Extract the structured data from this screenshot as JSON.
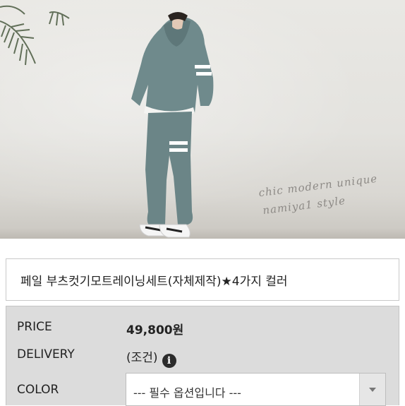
{
  "photo": {
    "alt_script_line1": "chic modern unique",
    "alt_script_line2": "namiya1 style"
  },
  "product": {
    "title": "페일 부츠컷기모트레이닝세트(자체제작)★4가지 컬러"
  },
  "info": {
    "price_label": "PRICE",
    "price_value": "49,800원",
    "delivery_label": "DELIVERY",
    "delivery_value": "(조건)",
    "color_label": "COLOR",
    "color_select_value": "--- 필수 옵션입니다 ---"
  },
  "icons": {
    "info": "info-icon",
    "dropdown": "chevron-down-icon"
  },
  "colors": {
    "tracksuit": "#6f8a8c",
    "panel_bg": "#dcdcdc"
  }
}
